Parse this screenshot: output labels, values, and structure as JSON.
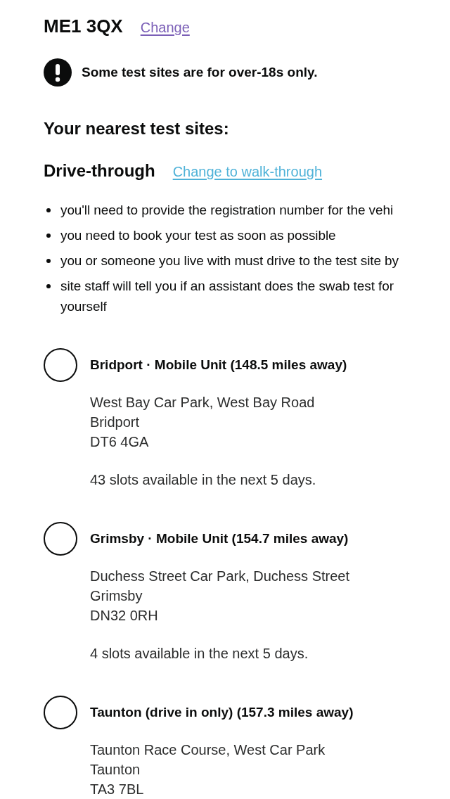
{
  "postcode": {
    "value": "ME1 3QX",
    "change_link": "Change"
  },
  "warning": {
    "text": "Some test sites are for over-18s only."
  },
  "heading": "Your nearest test sites:",
  "test_type": {
    "title": "Drive-through",
    "change_link": "Change to walk-through"
  },
  "requirements": [
    {
      "lines": [
        "you'll need to provide the registration number for the vehi"
      ]
    },
    {
      "lines": [
        "you need to book your test as soon as possible"
      ]
    },
    {
      "lines": [
        "you or someone you live with must drive to the test site by"
      ]
    },
    {
      "lines": [
        "site staff will tell you if an assistant does the swab test for",
        "yourself"
      ]
    }
  ],
  "sites": [
    {
      "name": "Bridport · Mobile Unit (148.5 miles away)",
      "selected": false,
      "address": [
        "West Bay Car Park, West Bay Road",
        "Bridport",
        "DT6 4GA"
      ],
      "availability": "43 slots available in the next 5 days."
    },
    {
      "name": "Grimsby · Mobile Unit (154.7 miles away)",
      "selected": false,
      "address": [
        "Duchess Street Car Park, Duchess Street",
        "Grimsby",
        "DN32 0RH"
      ],
      "availability": "4 slots available in the next 5 days."
    },
    {
      "name": "Taunton (drive in only) (157.3 miles away)",
      "selected": false,
      "address": [
        "Taunton Race Course, West Car Park",
        "Taunton",
        "TA3 7BL"
      ]
    }
  ]
}
